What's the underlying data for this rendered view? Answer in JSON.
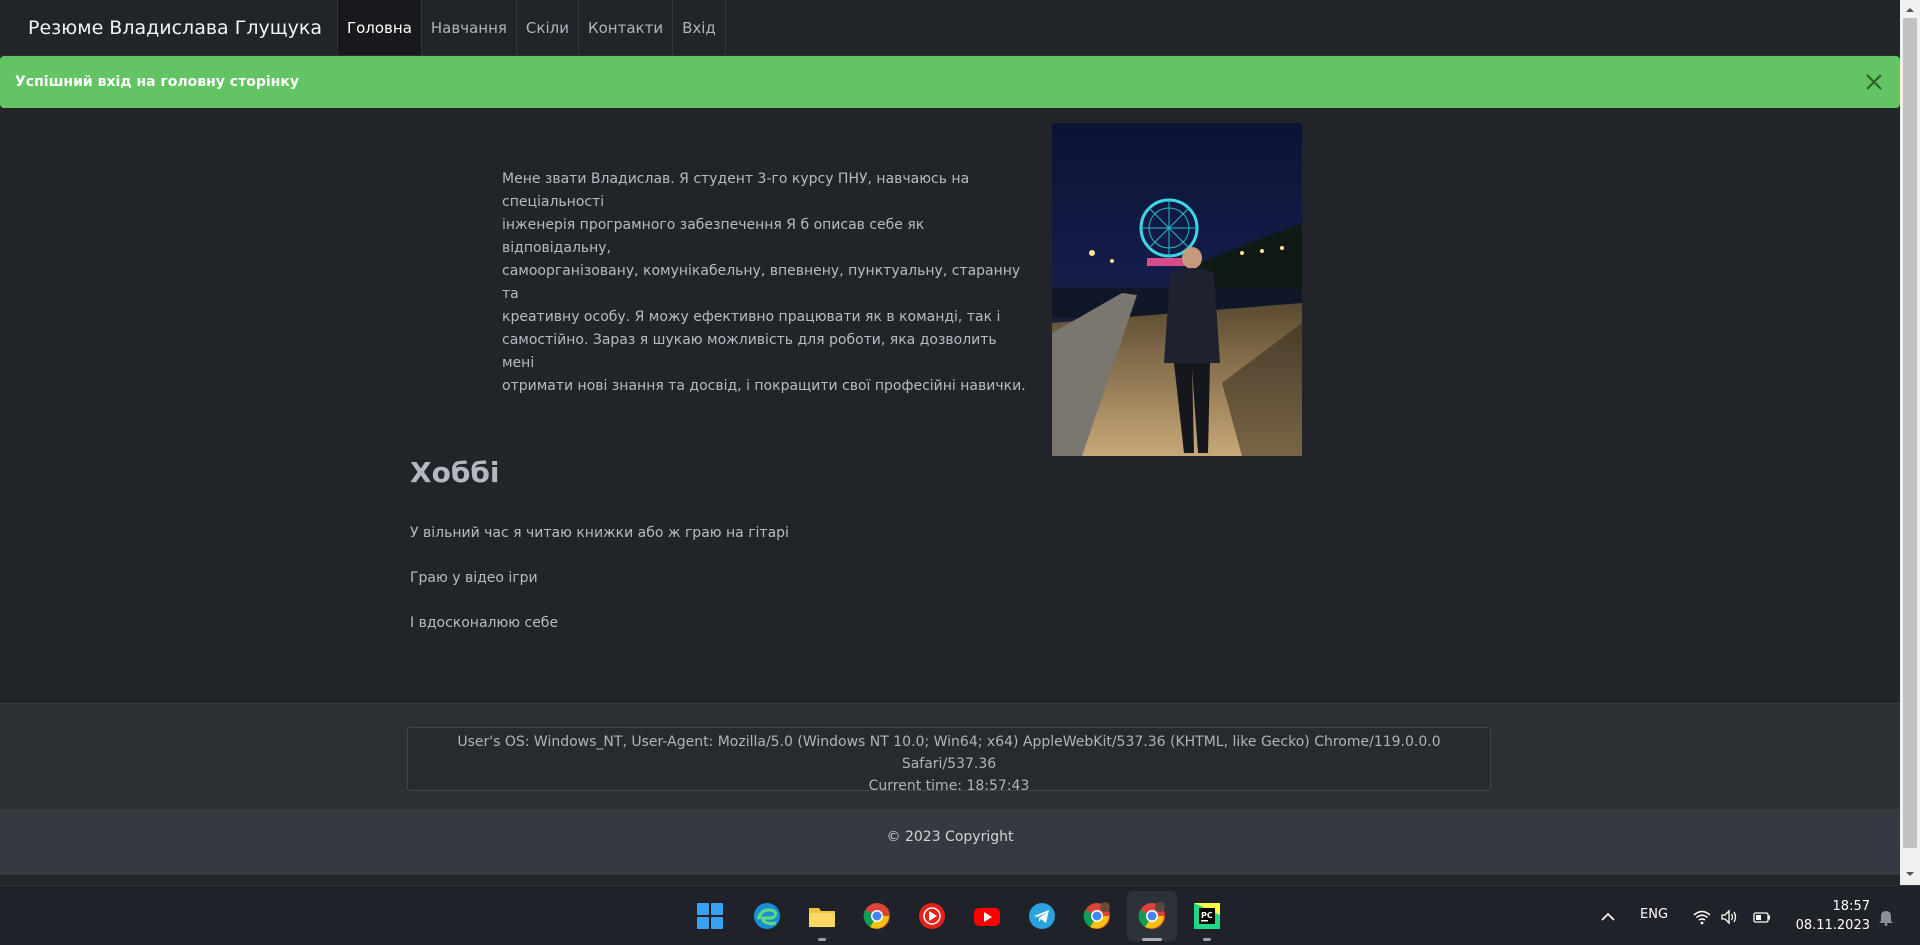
{
  "navbar": {
    "brand": "Резюме Владислава Глущука",
    "items": [
      {
        "label": "Головна",
        "active": true
      },
      {
        "label": "Навчання",
        "active": false
      },
      {
        "label": "Скіли",
        "active": false
      },
      {
        "label": "Контакти",
        "active": false
      },
      {
        "label": "Вхід",
        "active": false
      }
    ]
  },
  "alert": {
    "message": "Успішний вхід на головну сторінку",
    "close_icon": "close-icon",
    "color": "#62c462"
  },
  "about": {
    "lines": [
      "Мене звати Владислав. Я студент 3-го курсу ПНУ, навчаюсь на спеціальності",
      "інженерія програмного забезпечення Я б описав себе як відповідальну,",
      "самоорганізовану, комунікабельну, впевнену, пунктуальну, старанну та",
      "креативну особу. Я можу ефективно працювати як в команді, так і",
      "самостійно. Зараз я шукаю можливість для роботи, яка дозволить мені",
      "отримати нові знання та досвід, і покращити свої професійні навички."
    ]
  },
  "hobbies": {
    "title": "Хоббі",
    "items": [
      "У вільний час я читаю книжки або ж граю на гітарі",
      "Граю у відео ігри",
      "І вдосконалюю себе"
    ]
  },
  "footer": {
    "ua_line": "User's OS: Windows_NT, User-Agent: Mozilla/5.0 (Windows NT 10.0; Win64; x64) AppleWebKit/537.36 (KHTML, like Gecko) Chrome/119.0.0.0 Safari/537.36",
    "time_line": "Current time: 18:57:43",
    "copyright": "© 2023 Copyright"
  },
  "taskbar": {
    "apps": [
      "windows-start-icon",
      "edge-icon",
      "file-explorer-icon",
      "chrome-icon",
      "youtube-music-icon",
      "youtube-icon",
      "telegram-icon",
      "chrome-profile-icon",
      "chrome-active-icon",
      "pycharm-icon"
    ],
    "language": "ENG",
    "time": "18:57",
    "date": "08.11.2023"
  }
}
